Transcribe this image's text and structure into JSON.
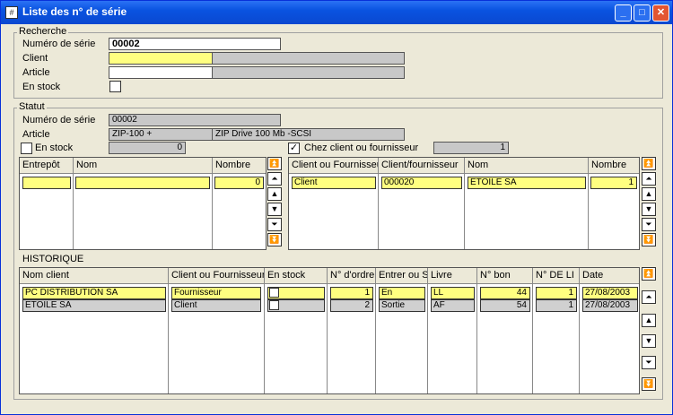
{
  "window": {
    "title": "Liste des n° de série"
  },
  "recherche": {
    "title": "Recherche",
    "numero_label": "Numéro de série",
    "numero_value": "00002",
    "client_label": "Client",
    "article_label": "Article",
    "stock_label": "En stock"
  },
  "statut": {
    "title": "Statut",
    "numero_label": "Numéro de série",
    "numero_value": "00002",
    "article_label": "Article",
    "article_code": "ZIP-100 +",
    "article_desc": "ZIP Drive 100 Mb -SCSI",
    "stock_label": "En stock",
    "stock_count": "0",
    "chez_label": "Chez client ou fournisseur",
    "chez_count": "1",
    "chez_checked": "✓"
  },
  "entrepot_grid": {
    "headers": [
      "Entrepôt",
      "Nom",
      "Nombre"
    ],
    "rows": [
      [
        "",
        "",
        "0"
      ]
    ]
  },
  "client_grid": {
    "headers": [
      "Client ou Fournisseur",
      "Client/fournisseur",
      "Nom",
      "Nombre"
    ],
    "rows": [
      [
        "Client",
        "000020",
        "ETOILE SA",
        "1"
      ]
    ]
  },
  "historique": {
    "title": "HISTORIQUE",
    "headers": [
      "Nom client",
      "Client ou Fournisseur",
      "En stock",
      "N° d'ordre",
      "Entrer ou S",
      "Livre",
      "N° bon",
      "N° DE LI",
      "Date"
    ],
    "rows": [
      [
        "PC DISTRIBUTION SA",
        "Fournisseur",
        "",
        "1",
        "En",
        "LL",
        "44",
        "1",
        "27/08/2003"
      ],
      [
        "ETOILE SA",
        "Client",
        "",
        "2",
        "Sortie",
        "AF",
        "54",
        "1",
        "27/08/2003"
      ]
    ]
  },
  "icons": {
    "first": "▲",
    "pgup": "▲",
    "up": "▲",
    "down": "▼",
    "pgdn": "▼",
    "last": "▼"
  }
}
